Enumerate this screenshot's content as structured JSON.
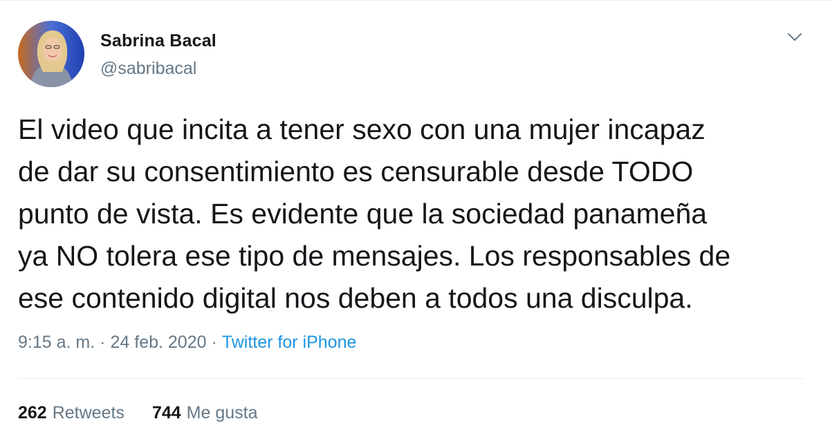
{
  "tweet": {
    "author": {
      "name": "Sabrina Bacal",
      "handle": "@sabribacal"
    },
    "text": "El video que incita a tener sexo con una mujer incapaz\nde dar su consentimiento es censurable desde TODO\npunto de vista. Es evidente que la sociedad panameña\nya NO tolera ese tipo de mensajes. Los responsables de\nese contenido digital nos deben a todos una disculpa.",
    "time": "9:15 a. m.",
    "separator": "·",
    "date": "24 feb. 2020",
    "source": "Twitter for iPhone",
    "retweets": {
      "count": "262",
      "label": "Retweets"
    },
    "likes": {
      "count": "744",
      "label": "Me gusta"
    }
  },
  "icons": {
    "caret": "chevron-down-icon"
  },
  "colors": {
    "text": "#14171a",
    "secondary": "#657786",
    "link": "#1b95e0",
    "divider": "#e6ecf0"
  }
}
